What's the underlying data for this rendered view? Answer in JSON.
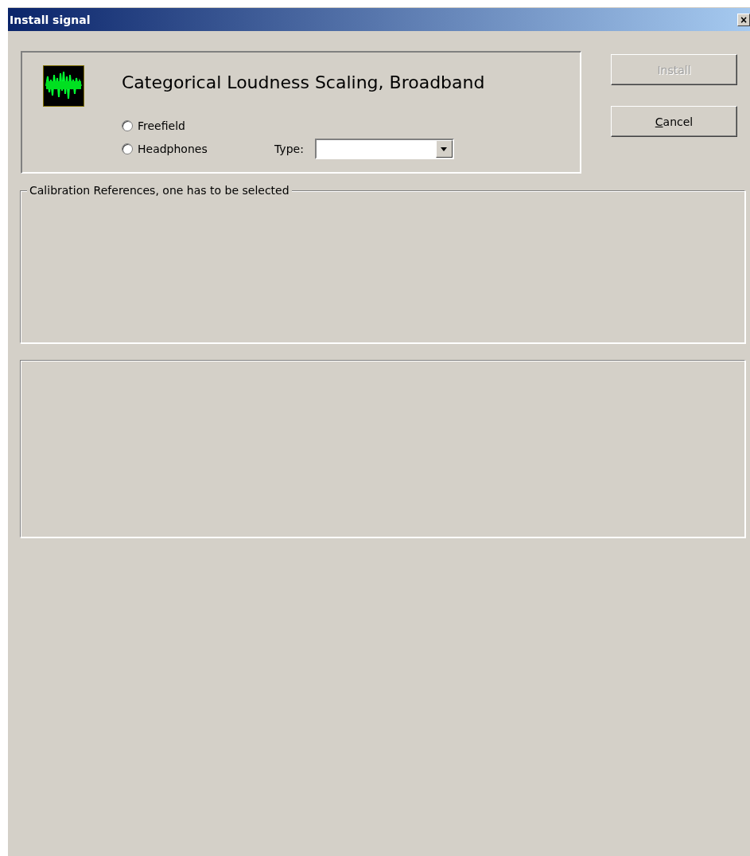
{
  "window": {
    "title": "Install signal",
    "close": "×"
  },
  "signal": {
    "name": "Categorical Loudness Scaling, Broadband"
  },
  "output": [
    {
      "label": "Freefield",
      "selected": false
    },
    {
      "label": "Headphones",
      "selected": false
    }
  ],
  "type": {
    "label": "Type:"
  },
  "buttons": [
    {
      "label": "Install",
      "disabled": true
    },
    {
      "label": "Cancel",
      "disabled": false,
      "mnemonic_underlined": true
    }
  ],
  "calibration": {
    "title": "Calibration References, one has to be selected"
  }
}
